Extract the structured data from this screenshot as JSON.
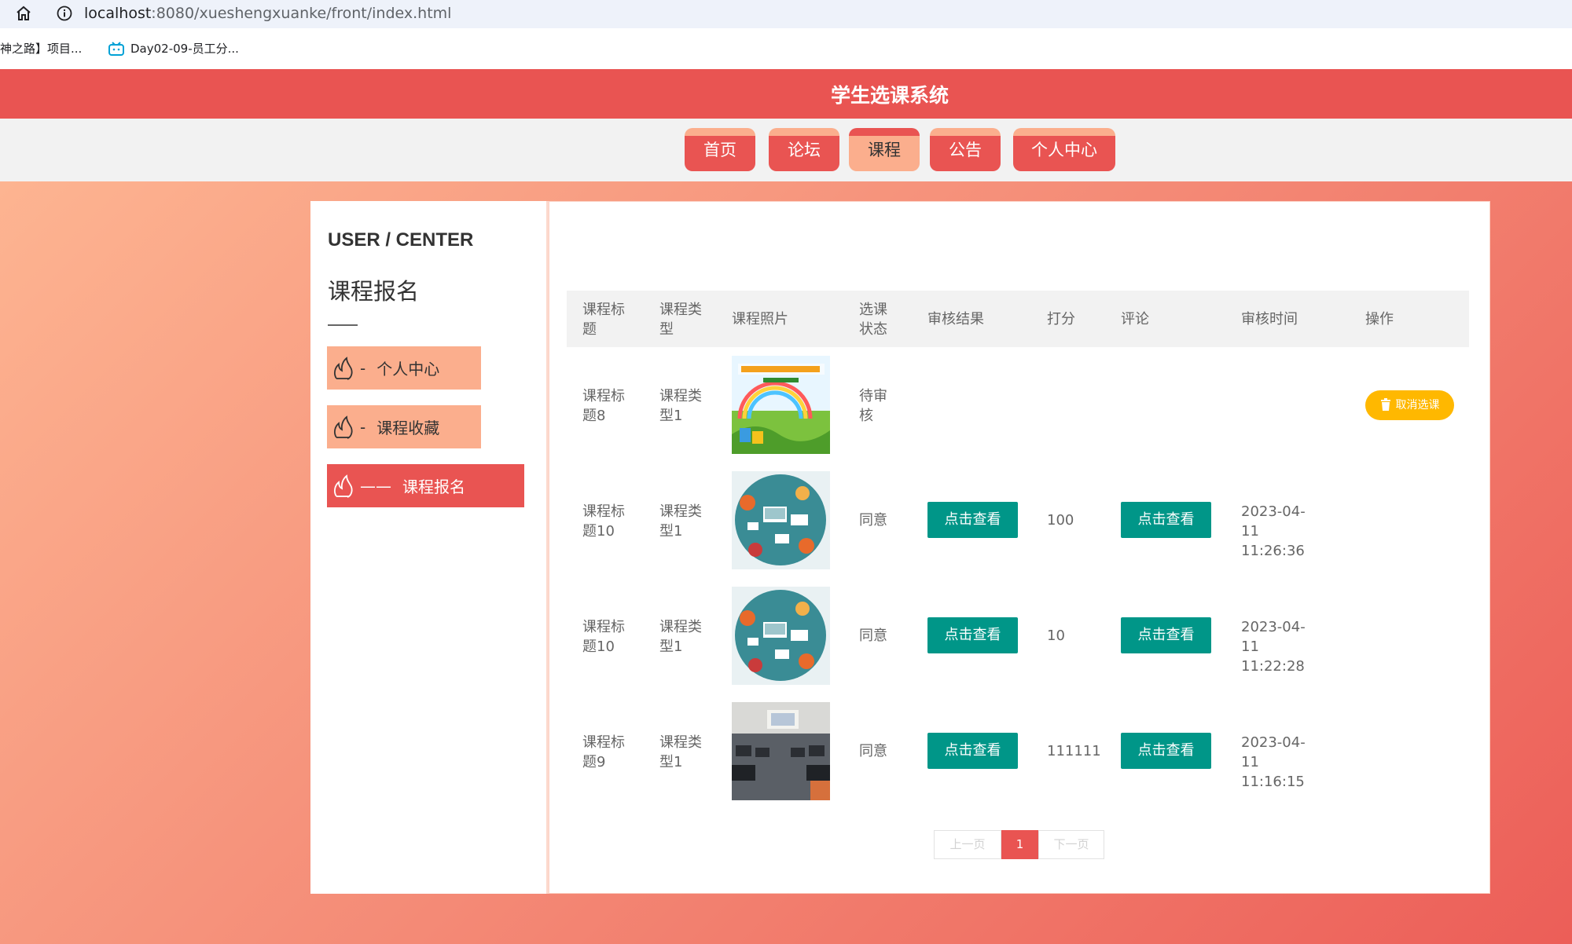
{
  "browser": {
    "url_host": "localhost",
    "url_rest": ":8080/xueshengxuanke/front/index.html",
    "bookmarks": [
      "神之路】项目...",
      "Day02-09-员工分..."
    ]
  },
  "site": {
    "title": "学生选课系统"
  },
  "nav": [
    {
      "label": "首页"
    },
    {
      "label": "论坛"
    },
    {
      "label": "课程"
    },
    {
      "label": "公告"
    },
    {
      "label": "个人中心"
    }
  ],
  "sidebar": {
    "title": "USER / CENTER",
    "subtitle": "课程报名",
    "items": [
      {
        "dash": "-",
        "label": "个人中心"
      },
      {
        "dash": "-",
        "label": "课程收藏"
      },
      {
        "dash": "——",
        "label": "课程报名"
      }
    ]
  },
  "table": {
    "headers": [
      "课程标题",
      "课程类型",
      "课程照片",
      "选课状态",
      "审核结果",
      "打分",
      "评论",
      "审核时间",
      "操作"
    ],
    "rows": [
      {
        "title": "课程标题8",
        "type": "课程类型1",
        "photo": "english-ppt",
        "status": "待审核",
        "result": "",
        "score": "",
        "comment": "",
        "time": "",
        "action": "取消选课"
      },
      {
        "title": "课程标题10",
        "type": "课程类型1",
        "photo": "office-desk",
        "status": "同意",
        "result": "点击查看",
        "score": "100",
        "comment": "点击查看",
        "time": "2023-04-11 11:26:36",
        "action": ""
      },
      {
        "title": "课程标题10",
        "type": "课程类型1",
        "photo": "office-desk",
        "status": "同意",
        "result": "点击查看",
        "score": "10",
        "comment": "点击查看",
        "time": "2023-04-11 11:22:28",
        "action": ""
      },
      {
        "title": "课程标题9",
        "type": "课程类型1",
        "photo": "classroom",
        "status": "同意",
        "result": "点击查看",
        "score": "111111",
        "comment": "点击查看",
        "time": "2023-04-11 11:16:15",
        "action": ""
      }
    ]
  },
  "pager": {
    "prev": "上一页",
    "current": "1",
    "next": "下一页"
  },
  "colors": {
    "primary": "#e95452",
    "secondary": "#fbae8d",
    "green": "#009688",
    "yellow": "#ffb800"
  }
}
